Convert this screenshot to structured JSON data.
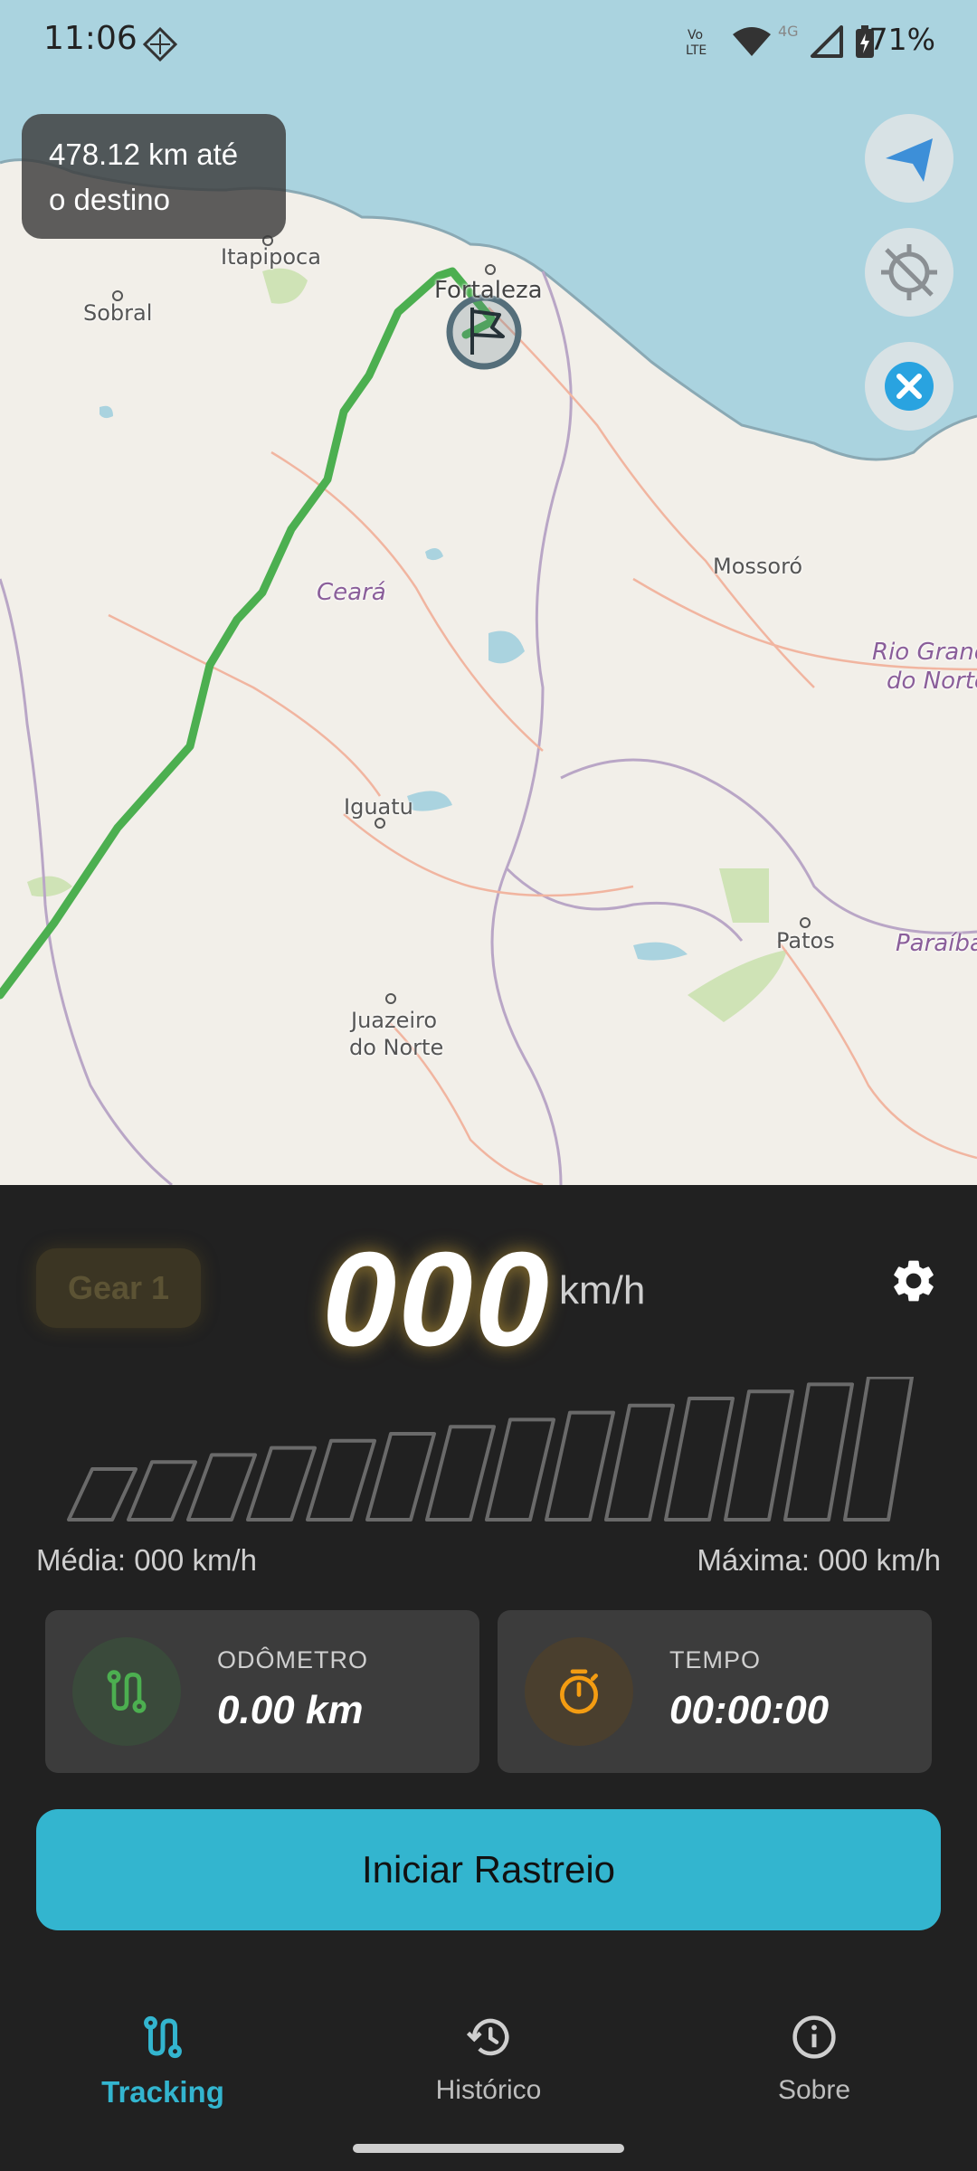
{
  "status_bar": {
    "time": "11:06",
    "battery": "71%"
  },
  "map": {
    "distance_label": "478.12 km até o destino",
    "labels": {
      "itapipoca": "Itapipoca",
      "sobral": "Sobral",
      "fortaleza": "Fortaleza",
      "mossoro": "Mossoró",
      "ceara": "Ceará",
      "rio_grande": "Rio Grand",
      "do_norte": "do Norte",
      "iguatu": "Iguatu",
      "patos": "Patos",
      "paraiba": "Paraíba",
      "juazeiro": "Juazeiro",
      "juazeiro2": "do Norte"
    },
    "route_color": "#4caf50",
    "water_color": "#aad3df"
  },
  "speed": {
    "gear": "Gear 1",
    "value": "000",
    "unit": "km/h",
    "average": "Média: 000 km/h",
    "max": "Máxima: 000 km/h",
    "bar_count": 14,
    "level": 0
  },
  "stats": {
    "odometer": {
      "label": "ODÔMETRO",
      "value": "0.00 km"
    },
    "time": {
      "label": "TEMPO",
      "value": "00:00:00"
    }
  },
  "actions": {
    "start_label": "Iniciar Rastreio"
  },
  "nav": {
    "tracking": "Tracking",
    "history": "Histórico",
    "about": "Sobre"
  },
  "colors": {
    "accent": "#33b5cf",
    "odometer_icon": "#4caf50",
    "timer_icon": "#f39c12"
  }
}
